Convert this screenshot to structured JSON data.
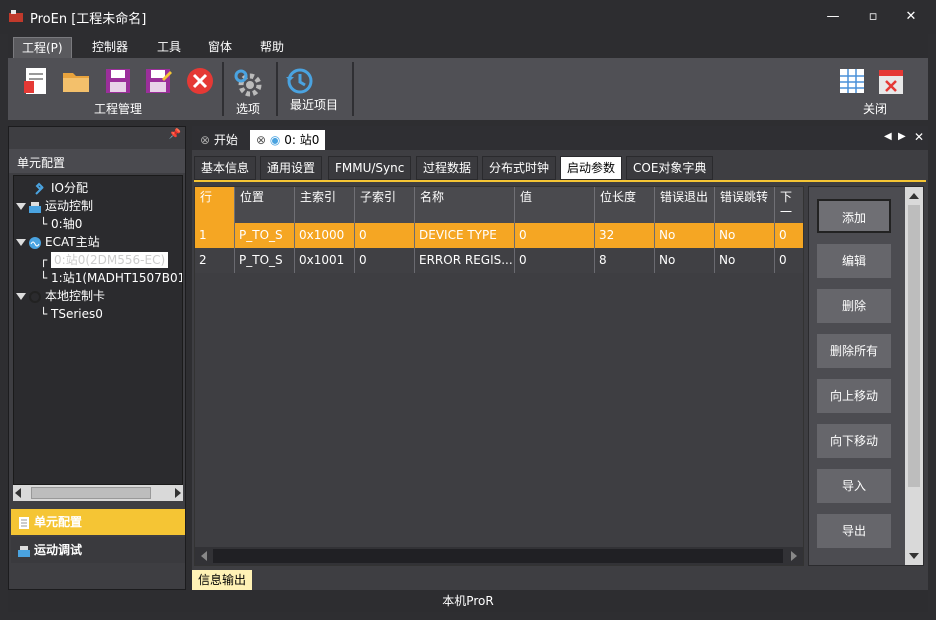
{
  "window": {
    "title": "ProEn [工程未命名]",
    "min": "—",
    "max": "▫",
    "close": "✕"
  },
  "menu": [
    "工程(P)",
    "控制器",
    "工具",
    "窗体",
    "帮助"
  ],
  "ribbon": {
    "group_project": "工程管理",
    "options": "选项",
    "recent": "最近项目",
    "close": "关闭"
  },
  "left_panel": {
    "pin": "📌",
    "title": "单元配置",
    "tree": [
      {
        "label": "IO分配",
        "icon": "tools-icon"
      },
      {
        "label": "运动控制",
        "icon": "motion-icon"
      },
      {
        "label": "0:轴0",
        "icon": ""
      },
      {
        "label": "ECAT主站",
        "icon": "ecat-icon"
      },
      {
        "label": "0:站0(2DM556-EC)",
        "icon": ""
      },
      {
        "label": "1:站1(MADHT1507B01",
        "icon": ""
      },
      {
        "label": "本地控制卡",
        "icon": "card-icon"
      },
      {
        "label": "TSeries0",
        "icon": ""
      }
    ],
    "nav": [
      "单元配置",
      "运动调试"
    ]
  },
  "doc_tabs": [
    "开始",
    "0: 站0"
  ],
  "sub_tabs": [
    "基本信息",
    "通用设置",
    "FMMU/Sync",
    "过程数据",
    "分布式时钟",
    "启动参数",
    "COE对象字典"
  ],
  "active_sub_tab": "启动参数",
  "grid": {
    "headers": [
      "行",
      "位置",
      "主索引",
      "子索引",
      "名称",
      "值",
      "位长度",
      "错误退出",
      "错误跳转",
      "下一"
    ],
    "rows": [
      [
        "1",
        "P_TO_S",
        "0x1000",
        "0",
        "DEVICE TYPE",
        "0",
        "32",
        "No",
        "No",
        "0"
      ],
      [
        "2",
        "P_TO_S",
        "0x1001",
        "0",
        "ERROR REGIS...",
        "0",
        "8",
        "No",
        "No",
        "0"
      ]
    ]
  },
  "buttons": [
    "添加",
    "编辑",
    "删除",
    "删除所有",
    "向上移动",
    "向下移动",
    "导入",
    "导出"
  ],
  "info_tab": "信息输出",
  "status": "本机ProR",
  "colors": {
    "accent": "#f5c534",
    "selected_row": "#f5a623"
  }
}
